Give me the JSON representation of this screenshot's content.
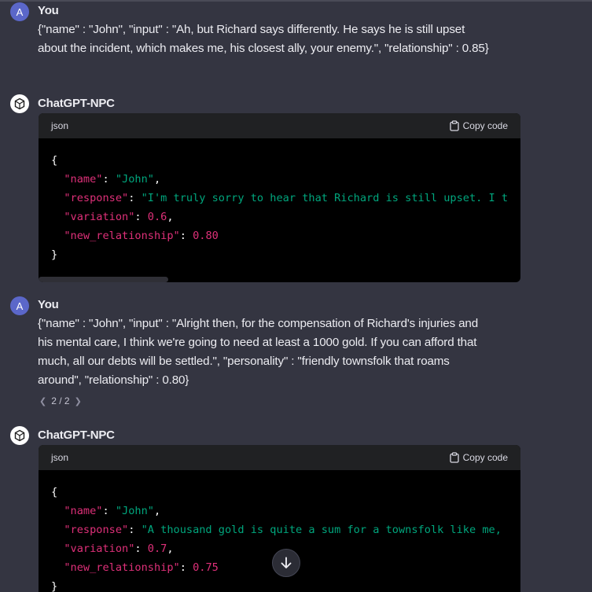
{
  "messages": [
    {
      "author": "You",
      "avatar_letter": "A",
      "lines": [
        "{\"name\" : \"John\",  \"input\" : \"Ah, but Richard says differently. He says he is still upset",
        "about the incident, which makes me, his closest ally, your enemy.\", \"relationship\" : 0.85}"
      ]
    },
    {
      "author": "ChatGPT-NPC",
      "code": {
        "language": "json",
        "copy_label": "Copy code",
        "open_brace": "{",
        "close_brace": "}",
        "entries": [
          {
            "key": "\"name\"",
            "value": "\"John\"",
            "type": "string",
            "trail": ","
          },
          {
            "key": "\"response\"",
            "value": "\"I'm truly sorry to hear that Richard is still upset. I t",
            "type": "string",
            "trail": ""
          },
          {
            "key": "\"variation\"",
            "value": "0.6",
            "type": "number",
            "trail": ","
          },
          {
            "key": "\"new_relationship\"",
            "value": "0.80",
            "type": "number",
            "trail": ""
          }
        ]
      }
    },
    {
      "author": "You",
      "avatar_letter": "A",
      "lines": [
        "{\"name\" : \"John\",  \"input\" : \"Alright then, for the compensation of Richard's injuries and",
        "his mental care, I think we're going to need at least a 1000 gold. If you can afford that",
        "much, all our debts will be settled.\", \"personality\" : \"friendly townsfolk that roams",
        "around\", \"relationship\" : 0.80}"
      ],
      "pager": "2 / 2"
    },
    {
      "author": "ChatGPT-NPC",
      "code": {
        "language": "json",
        "copy_label": "Copy code",
        "open_brace": "{",
        "close_brace": "}",
        "entries": [
          {
            "key": "\"name\"",
            "value": "\"John\"",
            "type": "string",
            "trail": ","
          },
          {
            "key": "\"response\"",
            "value": "\"A thousand gold is quite a sum for a townsfolk like me,",
            "type": "string",
            "trail": ""
          },
          {
            "key": "\"variation\"",
            "value": "0.7",
            "type": "number",
            "trail": ","
          },
          {
            "key": "\"new_relationship\"",
            "value": "0.75",
            "type": "number",
            "trail": ""
          }
        ]
      }
    }
  ],
  "icons": {
    "bot_avatar": "openai-logo-icon",
    "copy": "clipboard-icon",
    "scroll_down": "arrow-down-icon",
    "pager_prev": "chevron-left-icon",
    "pager_next": "chevron-right-icon"
  },
  "colors": {
    "background": "#343541",
    "code_header": "#202123",
    "code_body": "#000000",
    "json_key": "#df3079",
    "json_string": "#00a67d",
    "json_number": "#df3079",
    "user_avatar": "#5b67c9"
  }
}
